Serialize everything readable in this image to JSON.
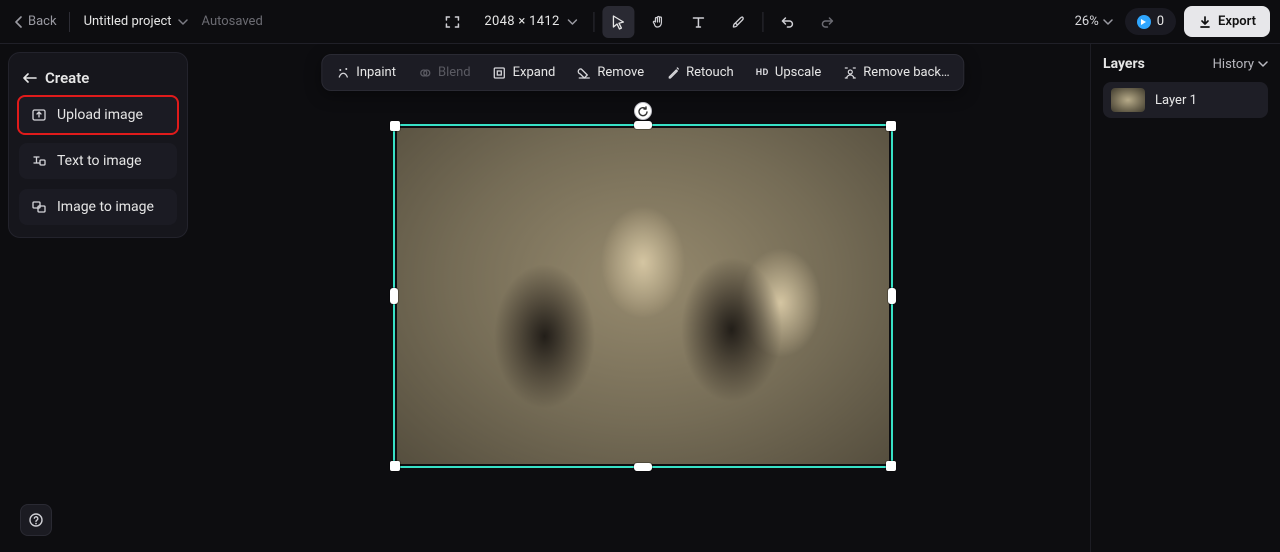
{
  "header": {
    "back_label": "Back",
    "project_name": "Untitled project",
    "autosaved_label": "Autosaved",
    "canvas_dimensions": "2048 × 1412",
    "zoom_label": "26%",
    "credits_count": "0",
    "export_label": "Export"
  },
  "sidebar": {
    "title": "Create",
    "items": [
      {
        "label": "Upload image"
      },
      {
        "label": "Text to image"
      },
      {
        "label": "Image to image"
      }
    ]
  },
  "context_toolbar": {
    "items": [
      {
        "label": "Inpaint",
        "disabled": false
      },
      {
        "label": "Blend",
        "disabled": true
      },
      {
        "label": "Expand",
        "disabled": false
      },
      {
        "label": "Remove",
        "disabled": false
      },
      {
        "label": "Retouch",
        "disabled": false
      },
      {
        "label": "Upscale",
        "disabled": false
      },
      {
        "label": "Remove back…",
        "disabled": false
      }
    ]
  },
  "layers_panel": {
    "title": "Layers",
    "history_label": "History",
    "layers": [
      {
        "name": "Layer 1"
      }
    ]
  }
}
